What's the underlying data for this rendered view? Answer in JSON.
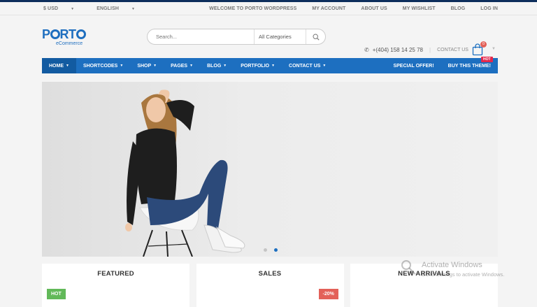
{
  "topbar": {
    "currency": "$ USD",
    "language": "ENGLISH",
    "welcome": "WELCOME TO PORTO WORDPRESS",
    "links": [
      "MY ACCOUNT",
      "ABOUT US",
      "MY WISHLIST",
      "BLOG",
      "LOG IN"
    ]
  },
  "logo": {
    "brand_pre": "P",
    "brand_mid": "RT",
    "brand_end": "O",
    "sub": "eCommerce"
  },
  "search": {
    "placeholder": "Search...",
    "category": "All Categories"
  },
  "contact": {
    "phone": "+(404) 158 14 25 78",
    "label": "CONTACT US"
  },
  "cart": {
    "count": "0"
  },
  "menu": {
    "items": [
      "HOME",
      "SHORTCODES",
      "SHOP",
      "PAGES",
      "BLOG",
      "PORTFOLIO",
      "CONTACT US"
    ],
    "right": [
      "SPECIAL OFFER!",
      "BUY THIS THEME!"
    ],
    "hot": "HOT"
  },
  "slider": {
    "slides": 2,
    "active": 2
  },
  "boxes": [
    {
      "title": "FEATURED",
      "tag": "HOT"
    },
    {
      "title": "SALES",
      "tag": "-20%"
    },
    {
      "title": "NEW ARRIVALS"
    }
  ],
  "watermark": {
    "title": "Activate Windows",
    "text": "Go to Settings to activate Windows."
  },
  "colors": {
    "brand": "#1d6fc0",
    "topline": "#0d2e5c",
    "hot": "#62b959",
    "sale": "#e36159",
    "badge": "#e3294d"
  }
}
